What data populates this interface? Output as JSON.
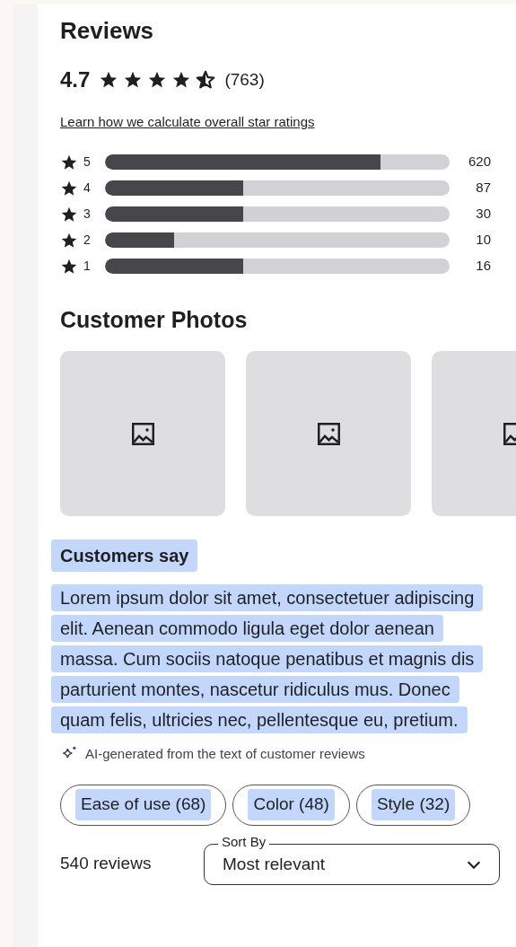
{
  "title": "Reviews",
  "rating": {
    "score": "4.7",
    "stars": 4.5,
    "count": "(763)"
  },
  "learn_link": "Learn how we calculate overall star ratings",
  "breakdown": [
    {
      "label": "5",
      "level": 0.8,
      "count": "620"
    },
    {
      "label": "4",
      "level": 0.4,
      "count": "87"
    },
    {
      "label": "3",
      "level": 0.4,
      "count": "30"
    },
    {
      "label": "2",
      "level": 0.2,
      "count": "10"
    },
    {
      "label": "1",
      "level": 0.4,
      "count": "16"
    }
  ],
  "photos_title": "Customer Photos",
  "photos": [
    {
      "kind": "placeholder"
    },
    {
      "kind": "placeholder"
    },
    {
      "kind": "placeholder"
    }
  ],
  "summary": {
    "title": "Customers say",
    "text": "Lorem ipsum dolor sit amet, consectetuer adipiscing elit. Aenean commodo ligula eget dolor aenean massa. Cum sociis natoque penatibus et magnis dis parturient montes, nascetur ridiculus mus. Donec quam felis, ultricies nec, pellentesque eu, pretium.",
    "note": "AI-generated from the text of customer reviews"
  },
  "chips": [
    "Ease of use (68)",
    "Color (48)",
    "Style (32)"
  ],
  "review_count": "540 reviews",
  "sort": {
    "label": "Sort By",
    "value": "Most relevant"
  }
}
